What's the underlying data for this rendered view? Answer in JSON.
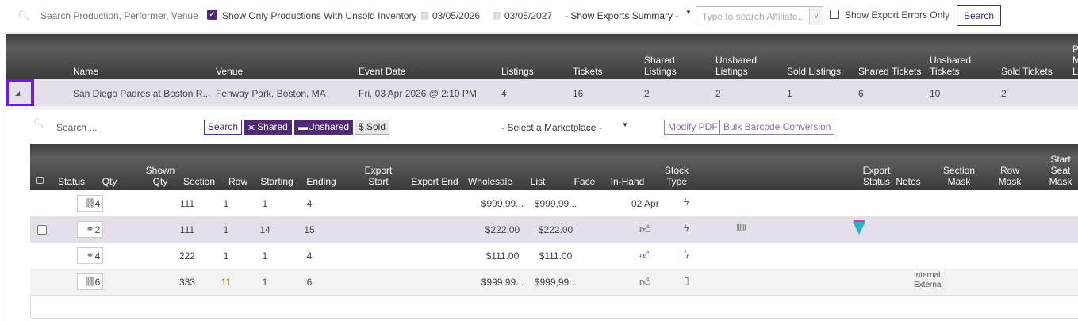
{
  "toolbar": {
    "search_placeholder": "Search Production, Performer, Venue",
    "unsold_label": "Show Only Productions With Unsold Inventory",
    "unsold_checked": true,
    "date_from": "03/05/2026",
    "date_to": "03/05/2027",
    "exports_summary": "- Show Exports Summary -",
    "affiliate_placeholder": "Type to search Affiliate...",
    "export_errors_label": "Show Export Errors Only",
    "export_errors_checked": false,
    "search_button": "Search"
  },
  "productions": {
    "columns": [
      "Name",
      "Venue",
      "Event Date",
      "Listings",
      "Tickets",
      "Shared Listings",
      "Unshared Listings",
      "Sold Listings",
      "Shared Tickets",
      "Unshared Tickets",
      "Sold Tickets",
      "P M L"
    ],
    "sort_column": "Event Date",
    "rows": [
      [
        "San Diego Padres at Boston R...",
        "Fenway Park, Boston, MA",
        "Fri, 03 Apr 2026 @ 2:10 PM",
        "4",
        "16",
        "2",
        "2",
        "1",
        "6",
        "10",
        "2",
        ""
      ]
    ]
  },
  "listings_toolbar": {
    "search_placeholder": "Search ...",
    "search_button": "Search",
    "shared_button": "Shared",
    "unshared_button": "Unshared",
    "sold_button": "$ Sold",
    "marketplace": "- Select a Marketplace -",
    "modify_pdf": "Modify PDF",
    "bulk_barcode": "Bulk Barcode Conversion"
  },
  "listings": {
    "columns": [
      "",
      "Status",
      "Qty",
      "Shown Qty",
      "Section",
      "Row",
      "Starting",
      "Ending",
      "Export Start",
      "Export End",
      "Wholesale",
      "List",
      "Face",
      "In-Hand",
      "Stock Type",
      "",
      "",
      "Export Status",
      "Notes",
      "Section Mask",
      "Row Mask",
      "Start Seat Mask"
    ],
    "sort_column": "Row",
    "rows": [
      {
        "status": "unlinked-icon",
        "qty": "4",
        "shown": "",
        "section": "111",
        "row": "1",
        "start": "1",
        "end": "4",
        "wholesale": "$999,99...",
        "list": "$999,99...",
        "face": "",
        "inhand": "02 Apr",
        "stock": "lightning-icon",
        "barcode": false,
        "marketplace_logo": false,
        "notes": ""
      },
      {
        "status": "linked-icon",
        "qty": "2",
        "shown": "",
        "section": "111",
        "row": "1",
        "start": "14",
        "end": "15",
        "wholesale": "$222.00",
        "list": "$222.00",
        "face": "",
        "inhand": "thumbs-up-icon",
        "stock": "lightning-icon",
        "barcode": true,
        "marketplace_logo": true,
        "notes": ""
      },
      {
        "status": "linked-icon",
        "qty": "4",
        "shown": "",
        "section": "222",
        "row": "1",
        "start": "1",
        "end": "4",
        "wholesale": "$111.00",
        "list": "$111.00",
        "face": "",
        "inhand": "thumbs-up-icon",
        "stock": "lightning-icon",
        "barcode": false,
        "marketplace_logo": false,
        "notes": ""
      },
      {
        "status": "unlinked-icon",
        "qty": "6",
        "shown": "",
        "section": "333",
        "row": "11",
        "start": "1",
        "end": "6",
        "wholesale": "$999,99...",
        "list": "$999,99...",
        "face": "",
        "inhand": "thumbs-up-icon",
        "stock": "mobile-icon",
        "barcode": false,
        "marketplace_logo": false,
        "notes": "Internal\nExternal"
      }
    ]
  },
  "colors": {
    "accent": "#4e2a74",
    "highlight_border": "#6a1fd0",
    "selected_row": "#e4e0ea",
    "sort_arrow": "#b0306e"
  }
}
